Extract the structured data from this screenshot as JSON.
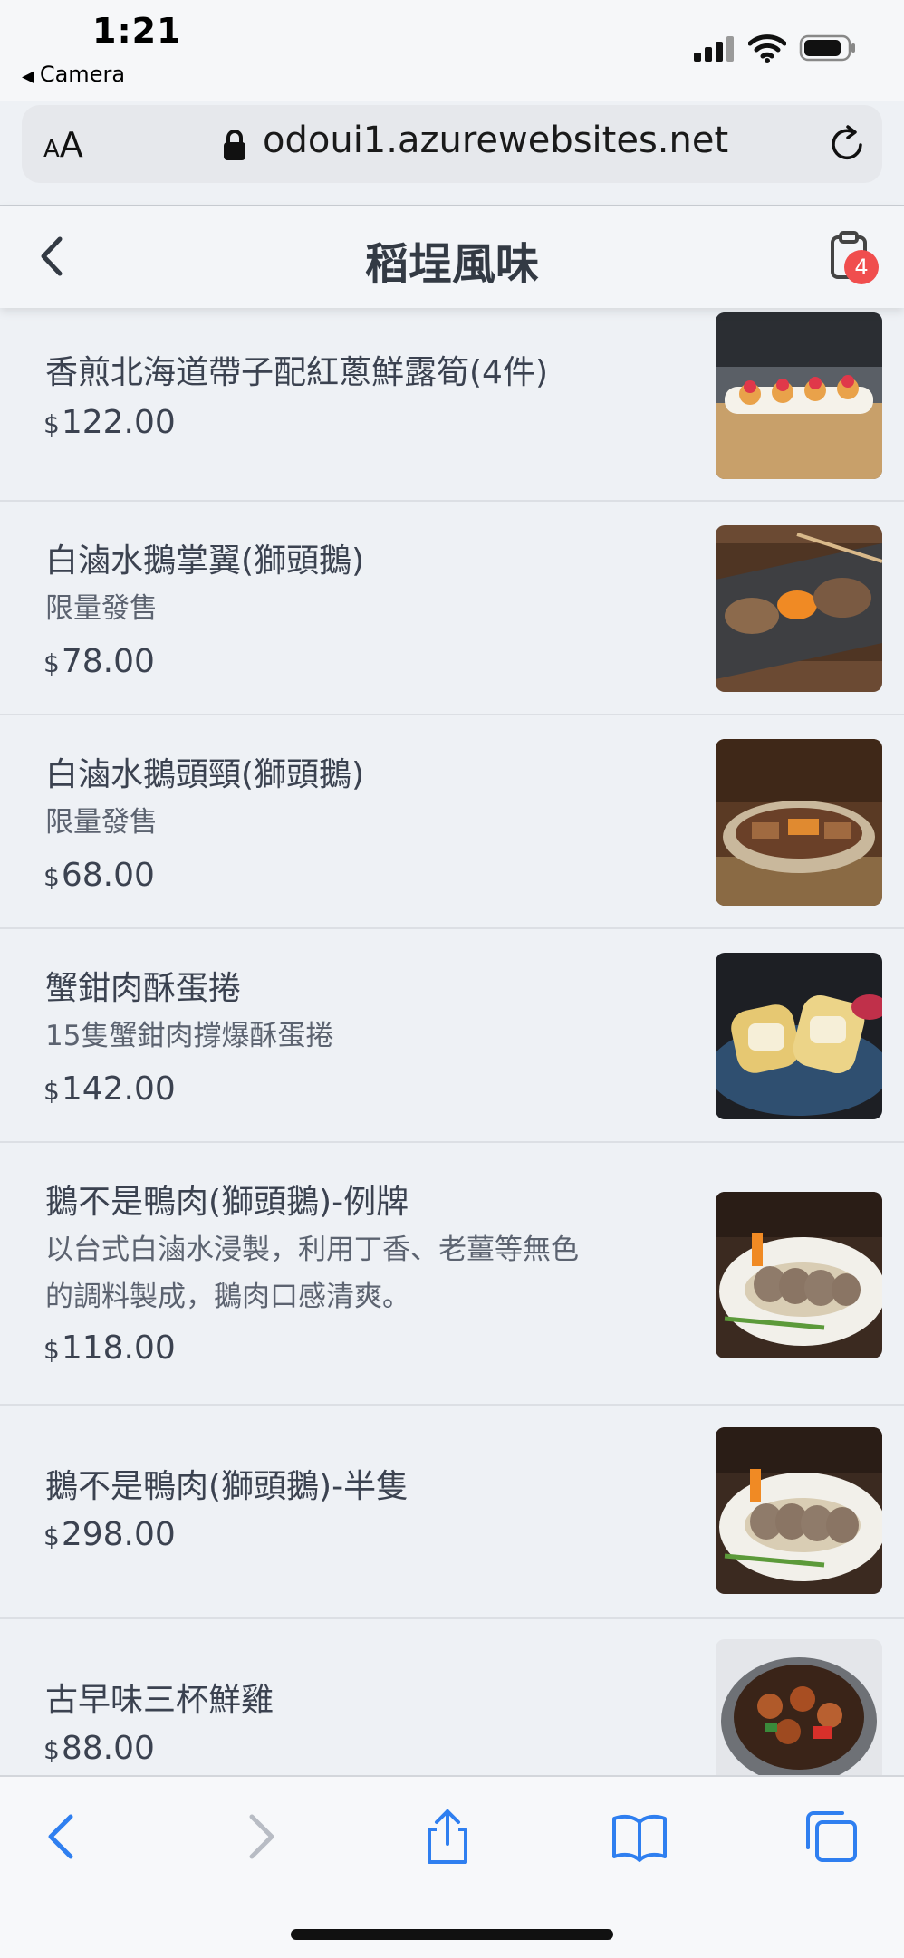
{
  "status_bar": {
    "time": "1:21",
    "back_app": "Camera"
  },
  "browser": {
    "text_size_label_small": "A",
    "text_size_label_large": "A",
    "url": "odoui1.azurewebsites.net"
  },
  "app_header": {
    "title": "稻埕風味",
    "cart_count": "4"
  },
  "currency_symbol": "$",
  "menu_items": [
    {
      "name": "香煎北海道帶子配紅蔥鮮露筍(4件)",
      "description": "",
      "price": "122.00"
    },
    {
      "name": "白滷水鵝掌翼(獅頭鵝)",
      "description": "限量發售",
      "price": "78.00"
    },
    {
      "name": "白滷水鵝頭頸(獅頭鵝)",
      "description": "限量發售",
      "price": "68.00"
    },
    {
      "name": "蟹鉗肉酥蛋捲",
      "description": "15隻蟹鉗肉撐爆酥蛋捲",
      "price": "142.00"
    },
    {
      "name": "鵝不是鴨肉(獅頭鵝)-例牌",
      "description_line1": "以台式白滷水浸製，利用丁香、老薑等無色",
      "description_line2": "的調料製成，鵝肉口感清爽。",
      "price": "118.00"
    },
    {
      "name": "鵝不是鴨肉(獅頭鵝)-半隻",
      "description": "",
      "price": "298.00"
    },
    {
      "name": "古早味三杯鮮雞",
      "description": "",
      "price": "88.00"
    }
  ],
  "colors": {
    "accent_blue": "#2f7ff0",
    "badge_red": "#f04e4e",
    "page_bg": "#eef1f5"
  },
  "icons": [
    "back-chevron-icon",
    "cart-clipboard-icon",
    "lock-icon",
    "reload-icon",
    "share-icon",
    "bookmarks-icon",
    "tabs-icon"
  ]
}
